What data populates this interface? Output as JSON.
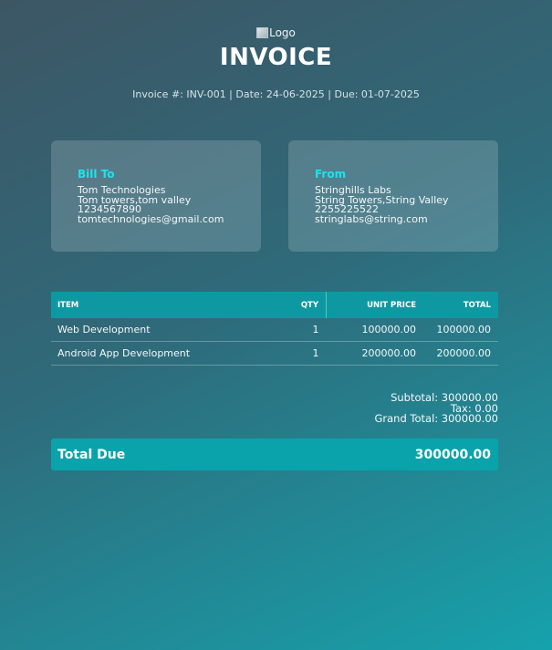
{
  "logo_alt": "Logo",
  "title": "INVOICE",
  "meta": "Invoice #: INV-001 | Date: 24-06-2025 | Due: 01-07-2025",
  "bill_to": {
    "heading": "Bill To",
    "lines": [
      "Tom Technologies",
      "Tom towers,tom valley",
      "1234567890",
      "tomtechnologies@gmail.com"
    ]
  },
  "from": {
    "heading": "From",
    "lines": [
      "Stringhills Labs",
      "String Towers,String Valley",
      "2255225522",
      "stringlabs@string.com"
    ]
  },
  "table": {
    "headers": {
      "item": "ITEM",
      "qty": "QTY",
      "unit_price": "UNIT PRICE",
      "total": "TOTAL"
    },
    "rows": [
      {
        "item": "Web Development",
        "qty": "1",
        "unit_price": "100000.00",
        "total": "100000.00"
      },
      {
        "item": "Android App Development",
        "qty": "1",
        "unit_price": "200000.00",
        "total": "200000.00"
      }
    ]
  },
  "totals": {
    "subtotal": "Subtotal: 300000.00",
    "tax": "Tax: 0.00",
    "grand_total": "Grand Total: 300000.00"
  },
  "total_due": {
    "label": "Total Due",
    "value": "300000.00"
  },
  "colors": {
    "accent": "#19e5ee",
    "table_header": "#0e99a2",
    "due_bar": "#0aa3ab"
  }
}
